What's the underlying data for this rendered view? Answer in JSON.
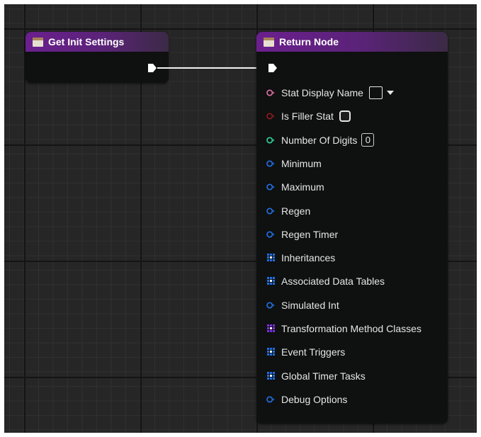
{
  "graph": {
    "colors": {
      "function_header": "#6b1f8e",
      "exec_wire": "#f2f2f2",
      "pin_string": "#da6fa0",
      "pin_bool": "#8c1a1a",
      "pin_int": "#2ed19a",
      "pin_struct": "#1f6fe0",
      "pin_class_array": "#7b2fe0"
    }
  },
  "get_init_node": {
    "title": "Get Init Settings",
    "icon": "function-icon"
  },
  "return_node": {
    "title": "Return Node",
    "icon": "function-icon",
    "pins": [
      {
        "label": "Stat Display Name",
        "pin_type": "circle",
        "color": "#da6fa0",
        "widget": "string-dropdown"
      },
      {
        "label": "Is Filler Stat",
        "pin_type": "circle",
        "color": "#8c1a1a",
        "widget": "checkbox",
        "checked": false
      },
      {
        "label": "Number Of Digits",
        "pin_type": "circle",
        "color": "#2ed19a",
        "widget": "number",
        "value": "0"
      },
      {
        "label": "Minimum",
        "pin_type": "circle",
        "color": "#1f6fe0"
      },
      {
        "label": "Maximum",
        "pin_type": "circle",
        "color": "#1f6fe0"
      },
      {
        "label": "Regen",
        "pin_type": "circle",
        "color": "#1f6fe0"
      },
      {
        "label": "Regen Timer",
        "pin_type": "circle",
        "color": "#1f6fe0"
      },
      {
        "label": "Inheritances",
        "pin_type": "array",
        "color": "#1f6fe0"
      },
      {
        "label": "Associated Data Tables",
        "pin_type": "array",
        "color": "#1f6fe0"
      },
      {
        "label": "Simulated Int",
        "pin_type": "circle",
        "color": "#1f6fe0"
      },
      {
        "label": "Transformation Method Classes",
        "pin_type": "array",
        "color": "#7b2fe0"
      },
      {
        "label": "Event Triggers",
        "pin_type": "array",
        "color": "#1f6fe0"
      },
      {
        "label": "Global Timer Tasks",
        "pin_type": "array",
        "color": "#1f6fe0"
      },
      {
        "label": "Debug Options",
        "pin_type": "circle",
        "color": "#1f6fe0"
      }
    ]
  }
}
